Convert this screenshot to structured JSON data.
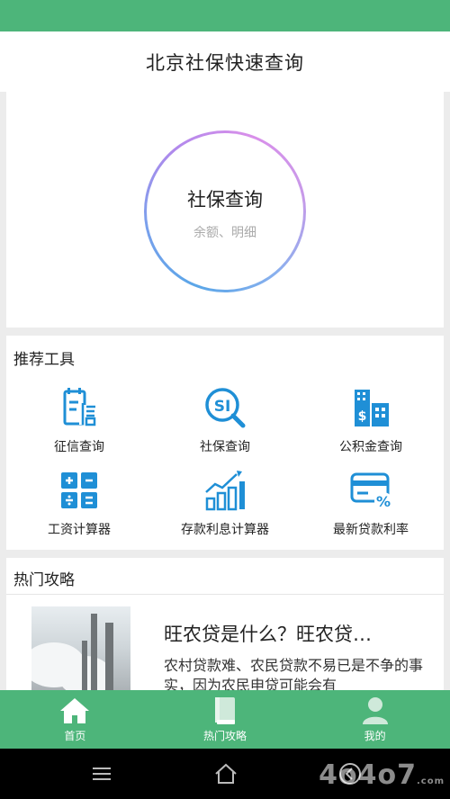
{
  "header": {
    "title": "北京社保快速查询"
  },
  "hero": {
    "title": "社保查询",
    "subtitle": "余额、明细"
  },
  "tools": {
    "section_title": "推荐工具",
    "items": [
      {
        "label": "征信查询",
        "icon": "credit-report-icon"
      },
      {
        "label": "社保查询",
        "icon": "si-search-icon"
      },
      {
        "label": "公积金查询",
        "icon": "building-fund-icon"
      },
      {
        "label": "工资计算器",
        "icon": "calculator-icon"
      },
      {
        "label": "存款利息计算器",
        "icon": "growth-chart-icon"
      },
      {
        "label": "最新贷款利率",
        "icon": "card-percent-icon"
      }
    ]
  },
  "guides": {
    "section_title": "热门攻略",
    "article": {
      "title": "旺农贷是什么？旺农贷…",
      "desc": "农村贷款难、农民贷款不易已是不争的事实，因为农民申贷可能会有"
    }
  },
  "tabbar": {
    "items": [
      {
        "label": "首页",
        "icon": "home-icon"
      },
      {
        "label": "热门攻略",
        "icon": "book-icon"
      },
      {
        "label": "我的",
        "icon": "user-icon"
      }
    ]
  },
  "colors": {
    "brand_green": "#4db57a",
    "icon_blue": "#1f8fd6",
    "ring_start": "#5aa6e8",
    "ring_end": "#d98fea"
  },
  "watermark": {
    "text": "4o4o7",
    "suffix": ".com"
  }
}
